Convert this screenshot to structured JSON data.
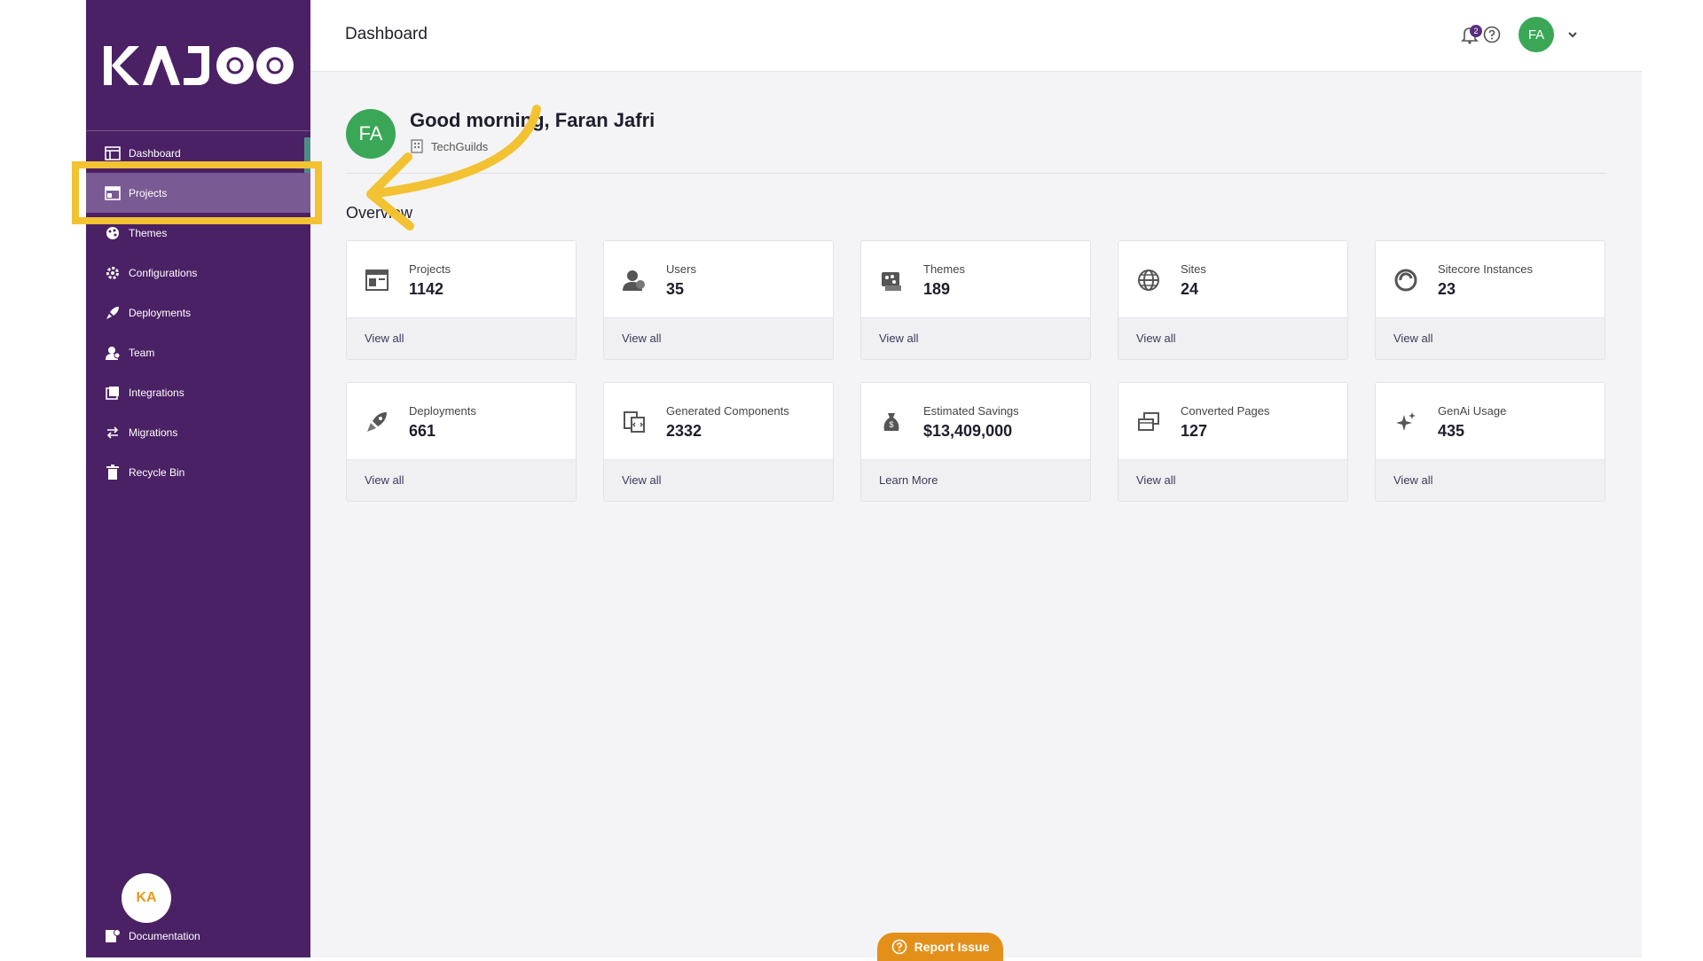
{
  "brand": {
    "logo_text": "KAJOO"
  },
  "sidebar": {
    "items": [
      {
        "label": "Dashboard",
        "icon": "dashboard-icon"
      },
      {
        "label": "Projects",
        "icon": "projects-icon"
      },
      {
        "label": "Themes",
        "icon": "themes-icon"
      },
      {
        "label": "Configurations",
        "icon": "gear-icon"
      },
      {
        "label": "Deployments",
        "icon": "rocket-icon"
      },
      {
        "label": "Team",
        "icon": "team-icon"
      },
      {
        "label": "Integrations",
        "icon": "integrations-icon"
      },
      {
        "label": "Migrations",
        "icon": "migrations-icon"
      },
      {
        "label": "Recycle Bin",
        "icon": "trash-icon"
      }
    ],
    "active_item": "Projects",
    "documentation": {
      "label": "Documentation",
      "badge": "KA"
    }
  },
  "topbar": {
    "title": "Dashboard",
    "notification_count": "2",
    "avatar_initials": "FA"
  },
  "greeting": {
    "avatar_initials": "FA",
    "title": "Good morning, Faran Jafri",
    "organization": "TechGuilds"
  },
  "overview": {
    "heading": "Overview",
    "cards": [
      {
        "label": "Projects",
        "value": "1142",
        "link": "View all",
        "icon": "projects-icon"
      },
      {
        "label": "Users",
        "value": "35",
        "link": "View all",
        "icon": "users-icon"
      },
      {
        "label": "Themes",
        "value": "189",
        "link": "View all",
        "icon": "themes-icon"
      },
      {
        "label": "Sites",
        "value": "24",
        "link": "View all",
        "icon": "globe-icon"
      },
      {
        "label": "Sitecore Instances",
        "value": "23",
        "link": "View all",
        "icon": "sitecore-icon"
      },
      {
        "label": "Deployments",
        "value": "661",
        "link": "View all",
        "icon": "rocket-icon"
      },
      {
        "label": "Generated Components",
        "value": "2332",
        "link": "View all",
        "icon": "components-icon"
      },
      {
        "label": "Estimated Savings",
        "value": "$13,409,000",
        "link": "Learn More",
        "icon": "savings-icon"
      },
      {
        "label": "Converted Pages",
        "value": "127",
        "link": "View all",
        "icon": "pages-icon"
      },
      {
        "label": "GenAi Usage",
        "value": "435",
        "link": "View all",
        "icon": "sparkle-icon"
      }
    ]
  },
  "report_issue": {
    "label": "Report Issue"
  },
  "colors": {
    "sidebar_bg": "#4b2165",
    "active_item_bg": "#7a5a93",
    "avatar_green": "#3aa757",
    "highlight_yellow": "#f2c232",
    "report_orange": "#e3901b"
  }
}
